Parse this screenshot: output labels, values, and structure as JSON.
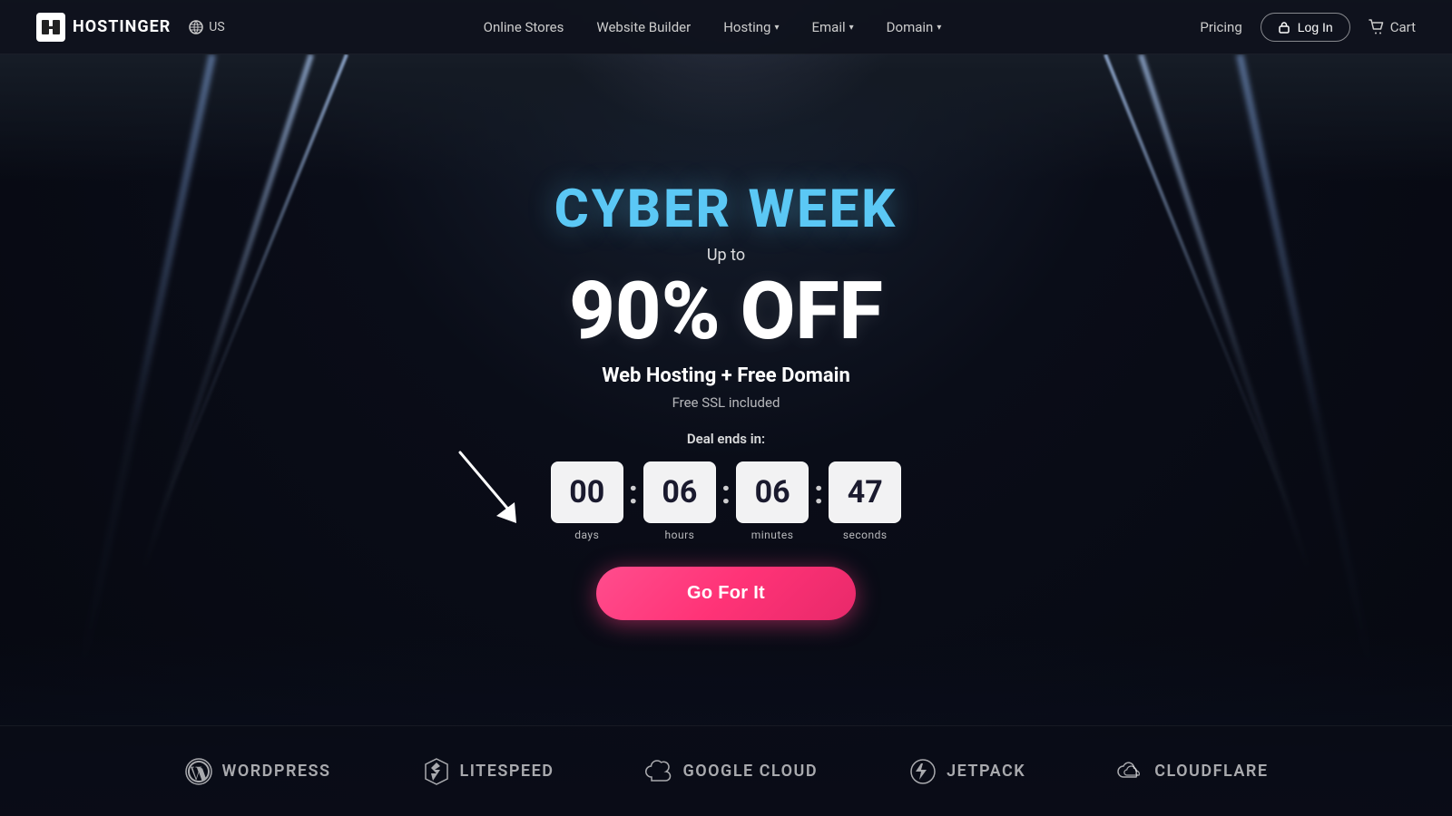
{
  "brand": {
    "name": "HOSTINGER"
  },
  "lang": {
    "label": "US"
  },
  "nav": {
    "items": [
      {
        "label": "Online Stores",
        "hasDropdown": false
      },
      {
        "label": "Website Builder",
        "hasDropdown": false
      },
      {
        "label": "Hosting",
        "hasDropdown": true
      },
      {
        "label": "Email",
        "hasDropdown": true
      },
      {
        "label": "Domain",
        "hasDropdown": true
      }
    ],
    "pricing": "Pricing",
    "login": "Log In",
    "cart": "Cart"
  },
  "hero": {
    "title": "CYBER WEEK",
    "up_to": "Up to",
    "discount": "90% OFF",
    "subtitle": "Web Hosting + Free Domain",
    "ssl": "Free SSL included",
    "deal_ends": "Deal ends in:",
    "cta": "Go For It"
  },
  "countdown": {
    "days": {
      "value": "00",
      "label": "days"
    },
    "hours": {
      "value": "06",
      "label": "hours"
    },
    "minutes": {
      "value": "06",
      "label": "minutes"
    },
    "seconds": {
      "value": "47",
      "label": "seconds"
    }
  },
  "partners": [
    {
      "name": "WordPress",
      "icon": "wordpress"
    },
    {
      "name": "LiteSpeed",
      "icon": "litespeed"
    },
    {
      "name": "Google Cloud",
      "icon": "googlecloud"
    },
    {
      "name": "Jetpack",
      "icon": "jetpack"
    },
    {
      "name": "Cloudflare",
      "icon": "cloudflare"
    }
  ]
}
